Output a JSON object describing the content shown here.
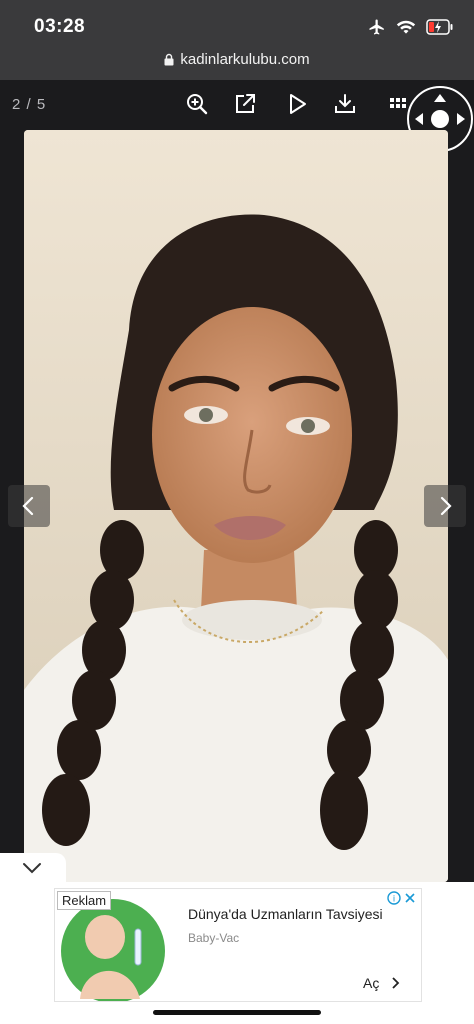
{
  "status_bar": {
    "time": "03:28",
    "icons": [
      "airplane-icon",
      "wifi-icon",
      "battery-low-charging-icon"
    ]
  },
  "browser": {
    "url": "kadinlarkulubu.com"
  },
  "viewer": {
    "counter": "2 / 5",
    "tools": [
      "zoom-in-icon",
      "open-external-icon",
      "play-icon",
      "download-icon",
      "grid-icon"
    ],
    "image_alt": "Portrait of a young woman with braided hair wearing a white sweatshirt"
  },
  "ad": {
    "badge": "Reklam",
    "title": "Dünya'da Uzmanların Tavsiyesi",
    "advertiser": "Baby-Vac",
    "cta": "Aç"
  },
  "colors": {
    "bar": "#3a3a3c",
    "viewer_bg": "#1b1b1d",
    "battery": "#ff3b30"
  }
}
